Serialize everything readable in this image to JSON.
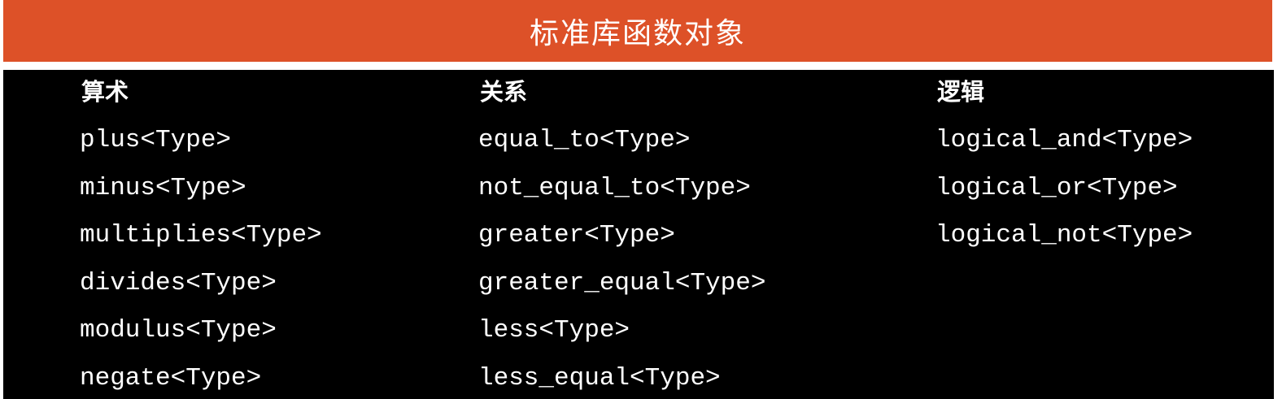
{
  "title": "标准库函数对象",
  "colors": {
    "title_bar": "#dd5128",
    "body_background": "#000000",
    "text": "#ffffff"
  },
  "columns": [
    {
      "heading": "算术",
      "items": [
        "plus<Type>",
        "minus<Type>",
        "multiplies<Type>",
        "divides<Type>",
        "modulus<Type>",
        "negate<Type>"
      ]
    },
    {
      "heading": "关系",
      "items": [
        "equal_to<Type>",
        "not_equal_to<Type>",
        "greater<Type>",
        "greater_equal<Type>",
        "less<Type>",
        "less_equal<Type>"
      ]
    },
    {
      "heading": "逻辑",
      "items": [
        "logical_and<Type>",
        "logical_or<Type>",
        "logical_not<Type>"
      ]
    }
  ]
}
